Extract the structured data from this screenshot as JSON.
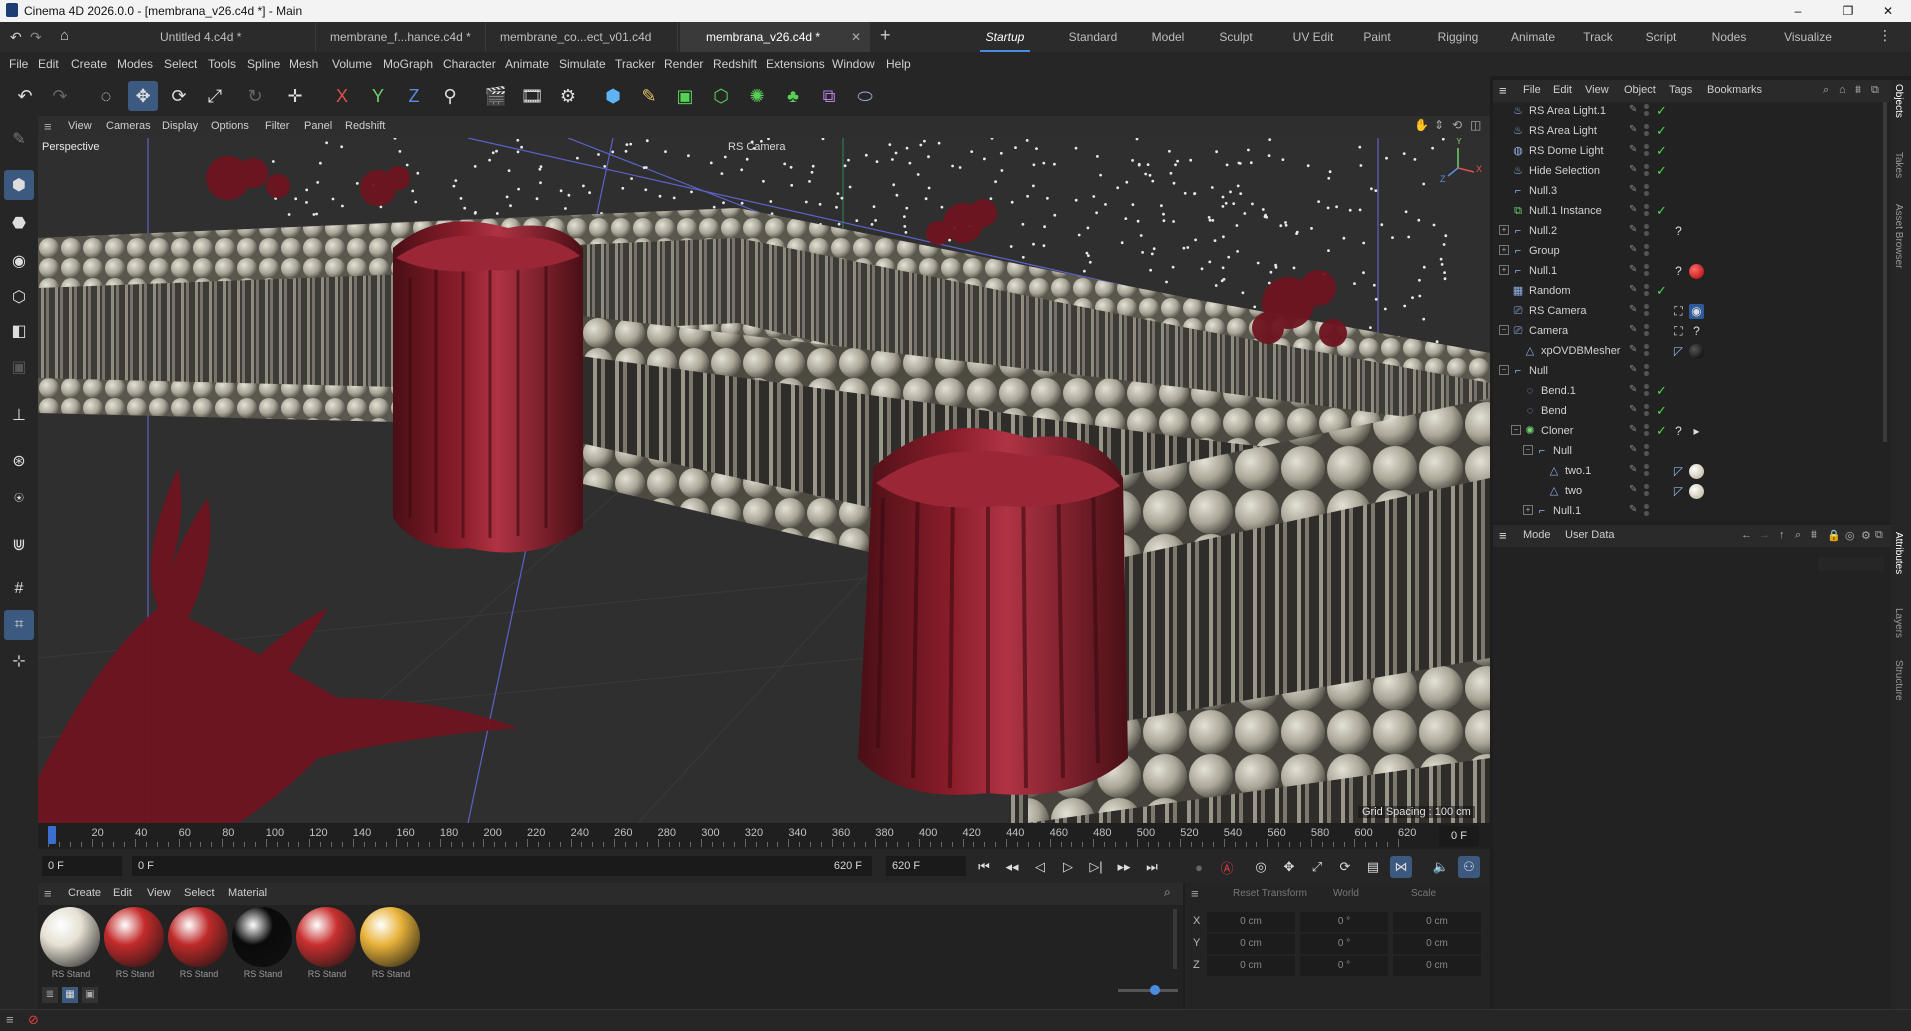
{
  "window": {
    "title": "Cinema 4D 2026.0.0 - [membrana_v26.c4d *] - Main",
    "minimize": "–",
    "maximize": "❐",
    "close": "✕"
  },
  "doc_tabs": [
    {
      "label": "Untitled 4.c4d *",
      "active": false
    },
    {
      "label": "membrane_f...hance.c4d *",
      "active": false
    },
    {
      "label": "membrane_co...ect_v01.c4d",
      "active": false
    },
    {
      "label": "membrana_v26.c4d *",
      "active": true
    }
  ],
  "add_tab": "+",
  "close_tab": "✕",
  "layouts": [
    "Startup",
    "Standard",
    "Model",
    "Sculpt",
    "UV Edit",
    "Paint",
    "Rigging",
    "Animate",
    "Track",
    "Script",
    "Nodes",
    "Visualize"
  ],
  "active_layout": "Startup",
  "menu": [
    "File",
    "Edit",
    "Create",
    "Modes",
    "Select",
    "Tools",
    "Spline",
    "Mesh",
    "Volume",
    "MoGraph",
    "Character",
    "Animate",
    "Simulate",
    "Tracker",
    "Render",
    "Redshift",
    "Extensions",
    "Window",
    "Help"
  ],
  "viewport": {
    "menu": [
      "View",
      "Cameras",
      "Display",
      "Options",
      "Filter",
      "Panel",
      "Redshift"
    ],
    "name": "Perspective",
    "camera": "RS Camera",
    "grid_spacing": "Grid Spacing : 100 cm",
    "axis_y": "Y",
    "axis_x": "X",
    "axis_z": "Z"
  },
  "timeline": {
    "ticks": [
      "0",
      "20",
      "40",
      "60",
      "80",
      "100",
      "120",
      "140",
      "160",
      "180",
      "200",
      "220",
      "240",
      "260",
      "280",
      "300",
      "320",
      "340",
      "360",
      "380",
      "400",
      "420",
      "440",
      "460",
      "480",
      "500",
      "520",
      "540",
      "560",
      "580",
      "600",
      "620"
    ],
    "current_frame": "0 F",
    "start": "0 F",
    "preview_start": "0 F",
    "preview_end": "620 F",
    "end": "620 F"
  },
  "materials": {
    "menu": [
      "Create",
      "Edit",
      "View",
      "Select",
      "Material"
    ],
    "items": [
      {
        "label": "RS Stand",
        "color": "#e6e1d4"
      },
      {
        "label": "RS Stand",
        "color": "#c42b2b"
      },
      {
        "label": "RS Stand",
        "color": "#bf2a2a"
      },
      {
        "label": "RS Stand",
        "color": "#0a0a0a"
      },
      {
        "label": "RS Stand",
        "color": "#c83030"
      },
      {
        "label": "RS Stand",
        "color": "#e8b33a"
      }
    ]
  },
  "coordinates": {
    "reset": "Reset Transform",
    "space": "World",
    "mode": "Scale",
    "rows": [
      {
        "axis": "X",
        "pos": "0 cm",
        "rot": "0 °",
        "scale": "0 cm"
      },
      {
        "axis": "Y",
        "pos": "0 cm",
        "rot": "0 °",
        "scale": "0 cm"
      },
      {
        "axis": "Z",
        "pos": "0 cm",
        "rot": "0 °",
        "scale": "0 cm"
      }
    ]
  },
  "object_manager": {
    "menu": [
      "File",
      "Edit",
      "View",
      "Object",
      "Tags",
      "Bookmarks"
    ],
    "objects": [
      {
        "name": "RS Area Light.1",
        "depth": 0,
        "expand": "",
        "icon": "light",
        "check": true,
        "tags": []
      },
      {
        "name": "RS Area Light",
        "depth": 0,
        "expand": "",
        "icon": "light",
        "check": true,
        "tags": []
      },
      {
        "name": "RS Dome Light",
        "depth": 0,
        "expand": "",
        "icon": "dome",
        "check": true,
        "tags": []
      },
      {
        "name": "Hide Selection",
        "depth": 0,
        "expand": "",
        "icon": "light",
        "check": true,
        "tags": []
      },
      {
        "name": "Null.3",
        "depth": 0,
        "expand": "",
        "icon": "null",
        "check": false,
        "tags": []
      },
      {
        "name": "Null.1 Instance",
        "depth": 0,
        "expand": "",
        "icon": "instance",
        "check": true,
        "tags": []
      },
      {
        "name": "Null.2",
        "depth": 0,
        "expand": "+",
        "icon": "null",
        "check": false,
        "tags": [
          "?"
        ]
      },
      {
        "name": "Group",
        "depth": 0,
        "expand": "+",
        "icon": "null",
        "check": false,
        "tags": []
      },
      {
        "name": "Null.1",
        "depth": 0,
        "expand": "+",
        "icon": "null",
        "check": false,
        "tags": [
          "?",
          "red"
        ]
      },
      {
        "name": "Random",
        "depth": 0,
        "expand": "",
        "icon": "effector",
        "check": true,
        "tags": []
      },
      {
        "name": "RS Camera",
        "depth": 0,
        "expand": "",
        "icon": "camera",
        "check": false,
        "tags": [
          "target",
          "cam"
        ]
      },
      {
        "name": "Camera",
        "depth": 0,
        "expand": "−",
        "icon": "camera",
        "check": false,
        "tags": [
          "target",
          "?"
        ]
      },
      {
        "name": "xpOVDBMesher",
        "depth": 1,
        "expand": "",
        "icon": "mesher",
        "check": false,
        "tags": [
          "phong",
          "black"
        ]
      },
      {
        "name": "Null",
        "depth": 0,
        "expand": "−",
        "icon": "null",
        "check": false,
        "tags": []
      },
      {
        "name": "Bend.1",
        "depth": 1,
        "expand": "",
        "icon": "bend",
        "check": true,
        "tags": []
      },
      {
        "name": "Bend",
        "depth": 1,
        "expand": "",
        "icon": "bend",
        "check": true,
        "tags": []
      },
      {
        "name": "Cloner",
        "depth": 1,
        "expand": "−",
        "icon": "cloner",
        "check": true,
        "tags": [
          "?",
          "play"
        ]
      },
      {
        "name": "Null",
        "depth": 2,
        "expand": "−",
        "icon": "null",
        "check": false,
        "tags": []
      },
      {
        "name": "two.1",
        "depth": 3,
        "expand": "",
        "icon": "poly",
        "check": false,
        "tags": [
          "phong",
          "beige"
        ]
      },
      {
        "name": "two",
        "depth": 3,
        "expand": "",
        "icon": "poly",
        "check": false,
        "tags": [
          "phong",
          "beige"
        ]
      },
      {
        "name": "Null.1",
        "depth": 2,
        "expand": "+",
        "icon": "null",
        "check": false,
        "tags": []
      }
    ]
  },
  "attributes": {
    "menu": [
      "Mode",
      "User Data"
    ]
  },
  "side_tabs": {
    "top": [
      "Objects",
      "Takes",
      "Asset Browser"
    ],
    "bottom": [
      "Attributes",
      "Layers",
      "Structure"
    ]
  }
}
